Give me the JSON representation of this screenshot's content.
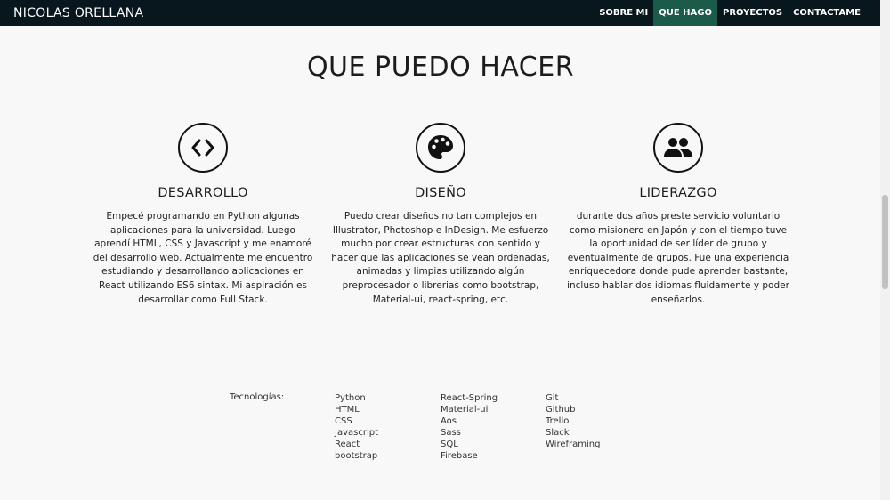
{
  "navbar": {
    "brand": "NICOLAS ORELLANA",
    "links": [
      {
        "label": "SOBRE MI"
      },
      {
        "label": "QUE HAGO",
        "active": true
      },
      {
        "label": "PROYECTOS"
      },
      {
        "label": "CONTACTAME"
      }
    ],
    "active_color": "#1c5a49",
    "background_color": "#08161d"
  },
  "section": {
    "title": "QUE PUEDO HACER",
    "cards": [
      {
        "icon": "code-icon",
        "title": "DESARROLLO",
        "text": "Empecé programando en Python algunas aplicaciones para la universidad. Luego aprendí HTML, CSS y Javascript y me enamoré del desarrollo web. Actualmente me encuentro estudiando y desarrollando aplicaciones en React utilizando ES6 sintax. Mi aspiración es desarrollar como Full Stack."
      },
      {
        "icon": "palette-icon",
        "title": "DISEÑO",
        "text": "Puedo crear diseños no tan complejos en Illustrator, Photoshop e InDesign. Me esfuerzo mucho por crear estructuras con sentido y hacer que las aplicaciones se vean ordenadas, animadas y limpias utilizando algún preprocesador o librerias como bootstrap, Material-ui, react-spring, etc."
      },
      {
        "icon": "people-icon",
        "title": "LIDERAZGO",
        "text": "durante dos años preste servicio voluntario como misionero en Japón y con el tiempo tuve la oportunidad de ser líder de grupo y eventualmente de grupos. Fue una experiencia enriquecedora donde pude aprender bastante, incluso hablar dos idiomas fluidamente y poder enseñarlos."
      }
    ]
  },
  "technologies": {
    "label": "Tecnologías:",
    "columns": [
      [
        "Python",
        "HTML",
        "CSS",
        "Javascript",
        "React",
        "bootstrap"
      ],
      [
        "React-Spring",
        "Material-ui",
        "Aos",
        "Sass",
        "SQL",
        "Firebase"
      ],
      [
        "Git",
        "Github",
        "Trello",
        "Slack",
        "Wireframing"
      ]
    ]
  }
}
